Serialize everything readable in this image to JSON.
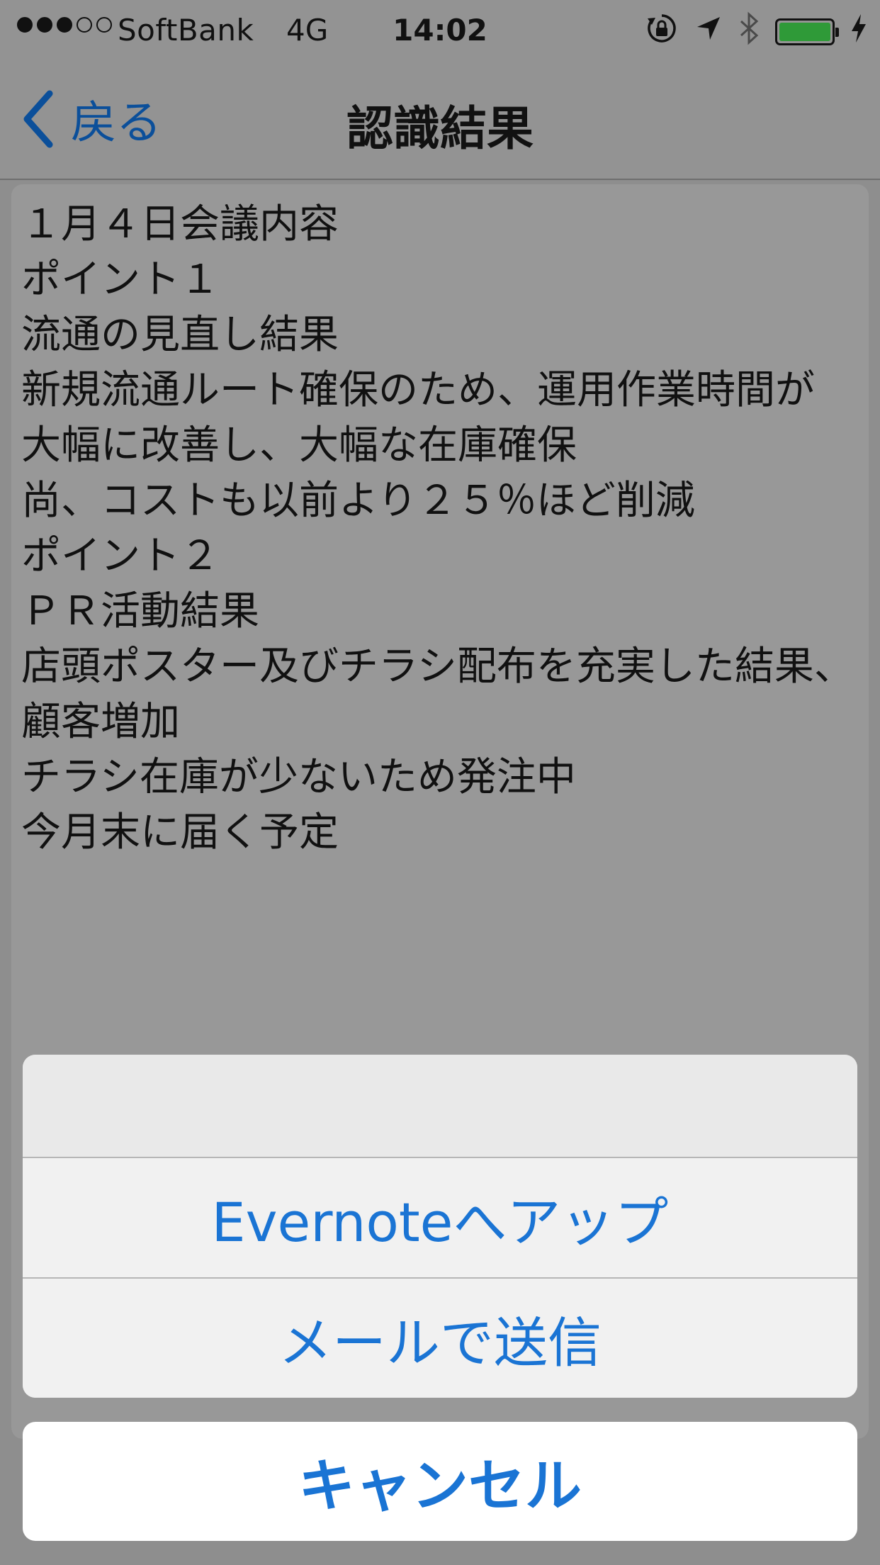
{
  "status_bar": {
    "signal_dots_filled": 3,
    "signal_dots_total": 5,
    "carrier": "SoftBank",
    "network": "4G",
    "time": "14:02",
    "icons": [
      "rotation-lock-icon",
      "location-arrow-icon",
      "bluetooth-icon",
      "battery-icon",
      "charging-bolt-icon"
    ],
    "battery_level": 1.0,
    "battery_color": "#2f9a38"
  },
  "nav": {
    "back_label": "戻る",
    "title": "認識結果"
  },
  "content": {
    "text": "１月４日会議内容\nポイント１\n流通の見直し結果\n新規流通ルート確保のため、運用作業時間が\n大幅に改善し、大幅な在庫確保\n尚、コストも以前より２５％ほど削減\nポイント２\nＰＲ活動結果\n店頭ポスター及びチラシ配布を充実した結果、\n顧客増加\nチラシ在庫が少ないため発注中\n今月末に届く予定"
  },
  "action_sheet": {
    "title": "",
    "actions": [
      {
        "label": "Evernoteへアップ"
      },
      {
        "label": "メールで送信"
      }
    ],
    "cancel_label": "キャンセル",
    "accent_color": "#1a74d4"
  }
}
